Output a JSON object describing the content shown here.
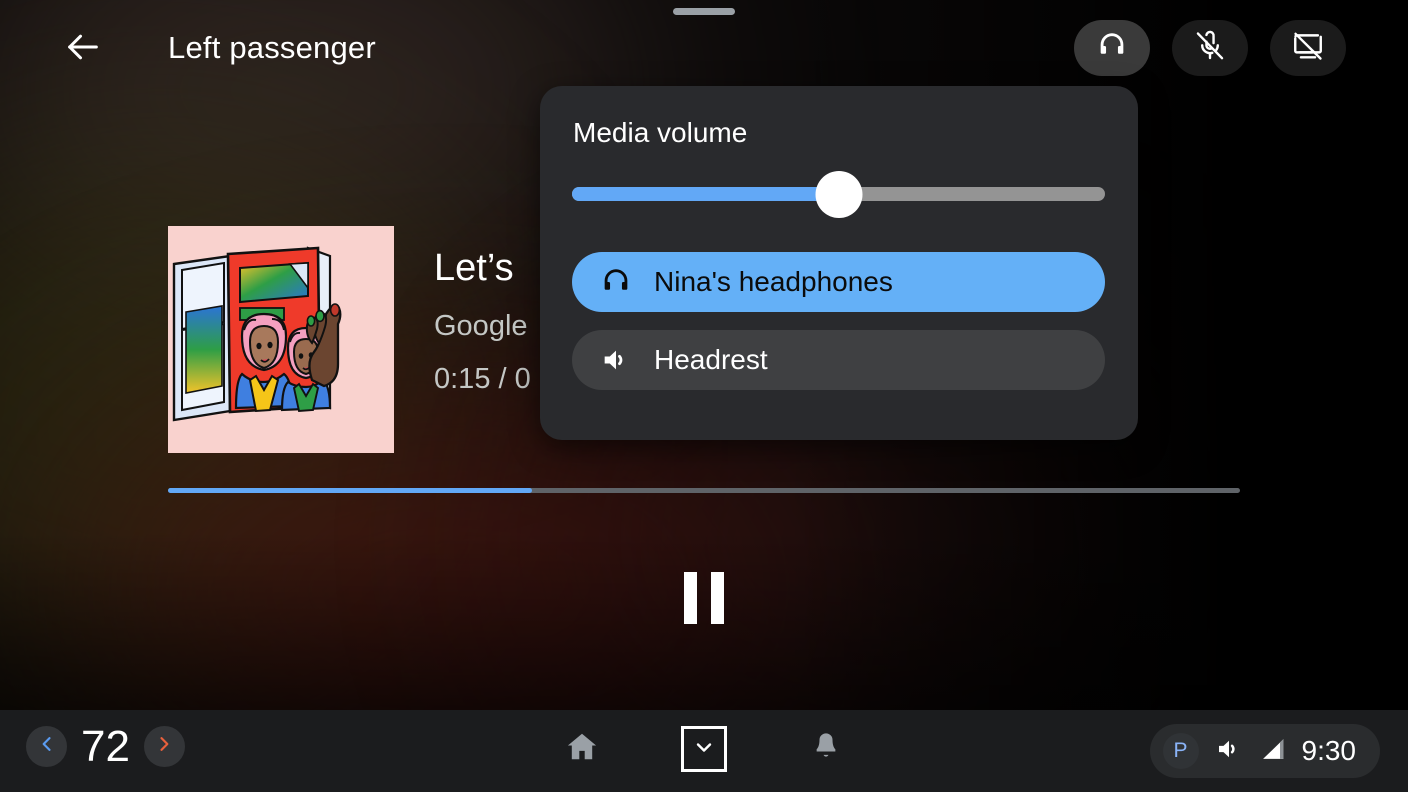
{
  "header": {
    "back_icon": "arrow-back-icon",
    "title": "Left passenger",
    "actions": [
      {
        "icon": "headphones-icon",
        "state": "active"
      },
      {
        "icon": "mic-off-icon",
        "state": "inactive"
      },
      {
        "icon": "screen-off-icon",
        "state": "inactive"
      }
    ]
  },
  "media": {
    "album_art_alt": "magazine-illustration-album-art",
    "title": "Let’s",
    "artist": "Google",
    "time": "0:15 / 0",
    "progress_percent": 34,
    "transport_icon": "pause-icon"
  },
  "popup": {
    "title": "Media volume",
    "slider": {
      "name": "media-volume-slider",
      "value_percent": 50,
      "fill_color": "#62a8f6",
      "track_color": "#949494",
      "thumb_color": "#ffffff"
    },
    "devices": [
      {
        "label": "Nina's headphones",
        "icon": "headphones-icon",
        "selected": true
      },
      {
        "label": "Headrest",
        "icon": "speaker-icon",
        "selected": false
      }
    ],
    "selected_color": "#64b0f7",
    "unselected_color": "#3f4042"
  },
  "bottom_bar": {
    "temperature": {
      "decrease_icon": "chevron-left-icon",
      "value": "72",
      "increase_icon": "chevron-right-icon",
      "decrease_color": "#5a9bf0",
      "increase_color": "#e8603c"
    },
    "nav": [
      {
        "icon": "home-icon"
      },
      {
        "icon": "chevron-down-icon"
      },
      {
        "icon": "bell-icon"
      }
    ],
    "status": {
      "gear_label": "P",
      "gear_color": "#8ab4f8",
      "volume_icon": "volume-icon",
      "signal_icon": "signal-bars-icon",
      "clock": "9:30"
    }
  }
}
